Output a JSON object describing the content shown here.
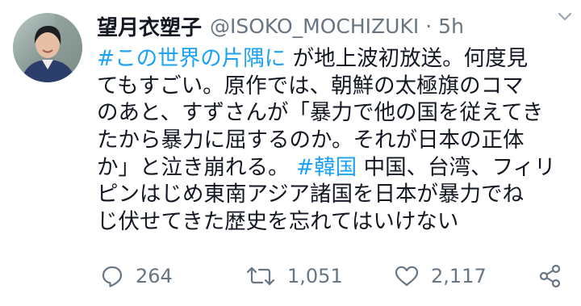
{
  "tweet": {
    "author": {
      "display_name": "望月衣塑子",
      "handle": "@ISOKO_MOCHIZUKI",
      "separator": "·",
      "time": "5h"
    },
    "body_lines": [
      [
        {
          "text": "#この世界の片隅に",
          "hashtag": true
        },
        {
          "text": " が地上波初放送。何度見"
        }
      ],
      [
        {
          "text": "てもすごい。原作では、朝鮮の太極旗のコマ"
        }
      ],
      [
        {
          "text": "のあと、すずさんが「暴力で他の国を従えてき"
        }
      ],
      [
        {
          "text": "たから暴力に屈するのか。それが日本の正体"
        }
      ],
      [
        {
          "text": "か」と泣き崩れる。 "
        },
        {
          "text": "#韓国",
          "hashtag": true
        },
        {
          "text": " 中国、台湾、フィリ"
        }
      ],
      [
        {
          "text": "ピンはじめ東南アジア諸国を日本が暴力でね"
        }
      ],
      [
        {
          "text": "じ伏せてきた歴史を忘れてはいけない"
        }
      ]
    ],
    "actions": {
      "reply_count": "264",
      "retweet_count": "1,051",
      "like_count": "2,117"
    }
  },
  "icons": {
    "more": "chevron-down-icon",
    "reply": "speech-bubble-icon",
    "retweet": "retweet-icon",
    "like": "heart-icon",
    "share": "share-icon"
  },
  "colors": {
    "hashtag": "#1da1f2",
    "secondary_text": "#687684",
    "primary_text": "#141823"
  }
}
